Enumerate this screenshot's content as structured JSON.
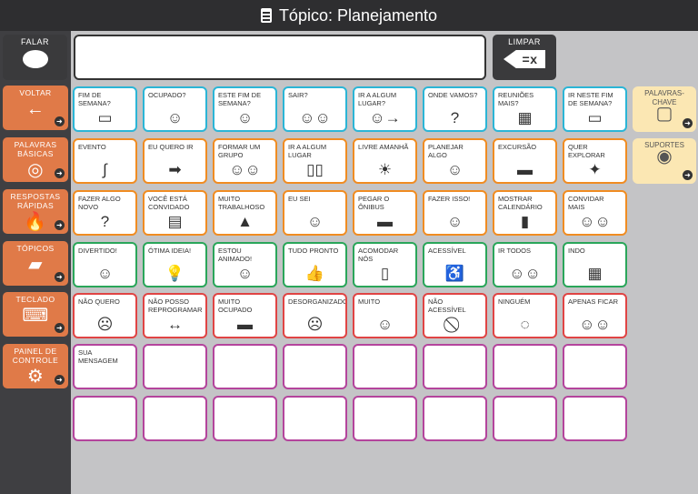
{
  "header": {
    "title": "Tópico: Planejamento",
    "icon": "notebook-icon"
  },
  "toolbar": {
    "speak_label": "Falar",
    "clear_label": "Limpar",
    "message": ""
  },
  "sidebar": [
    {
      "label": "Voltar",
      "icon": "←"
    },
    {
      "label": "Palavras Básicas",
      "icon": "◎"
    },
    {
      "label": "Respostas Rápidas",
      "icon": "🔥"
    },
    {
      "label": "Tópicos",
      "icon": "▰"
    },
    {
      "label": "Teclado",
      "icon": "⌨"
    },
    {
      "label": "Painel de controle",
      "icon": "⚙"
    }
  ],
  "keywords": [
    {
      "label": "Palavras-chave",
      "icon": "▢"
    },
    {
      "label": "Suportes",
      "icon": "◉"
    }
  ],
  "grid": [
    [
      {
        "t": "Fim de semana?",
        "i": "▭"
      },
      {
        "t": "Ocupado?",
        "i": "☺"
      },
      {
        "t": "Este fim de semana?",
        "i": "☺"
      },
      {
        "t": "Sair?",
        "i": "☺☺"
      },
      {
        "t": "Ir a algum lugar?",
        "i": "☺→"
      },
      {
        "t": "Onde vamos?",
        "i": "?"
      },
      {
        "t": "Reuniões mais?",
        "i": "▦"
      },
      {
        "t": "Ir neste fim de semana?",
        "i": "▭"
      }
    ],
    [
      {
        "t": "Evento",
        "i": "∫"
      },
      {
        "t": "Eu quero ir",
        "i": "➡"
      },
      {
        "t": "Formar um grupo",
        "i": "☺☺"
      },
      {
        "t": "Ir a algum lugar",
        "i": "▯▯"
      },
      {
        "t": "Livre amanhã",
        "i": "☀"
      },
      {
        "t": "Planejar algo",
        "i": "☺"
      },
      {
        "t": "Excursão",
        "i": "▬"
      },
      {
        "t": "Quer explorar",
        "i": "✦"
      }
    ],
    [
      {
        "t": "Fazer algo novo",
        "i": "?"
      },
      {
        "t": "Você está convidado",
        "i": "▤"
      },
      {
        "t": "Muito trabalhoso",
        "i": "▲"
      },
      {
        "t": "Eu sei",
        "i": "☺"
      },
      {
        "t": "Pegar o ônibus",
        "i": "▬"
      },
      {
        "t": "Fazer isso!",
        "i": "☺"
      },
      {
        "t": "Mostrar calendário",
        "i": "▮"
      },
      {
        "t": "Convidar mais",
        "i": "☺☺"
      }
    ],
    [
      {
        "t": "Divertido!",
        "i": "☺"
      },
      {
        "t": "Ótima ideia!",
        "i": "💡"
      },
      {
        "t": "Estou animado!",
        "i": "☺"
      },
      {
        "t": "Tudo pronto",
        "i": "👍"
      },
      {
        "t": "Acomodar nós",
        "i": "▯"
      },
      {
        "t": "Acessível",
        "i": "♿"
      },
      {
        "t": "Ir todos",
        "i": "☺☺"
      },
      {
        "t": "Indo",
        "i": "▦"
      }
    ],
    [
      {
        "t": "Não quero",
        "i": "☹"
      },
      {
        "t": "Não posso reprogramar",
        "i": "↔"
      },
      {
        "t": "Muito ocupado",
        "i": "▬"
      },
      {
        "t": "Desorganizado",
        "i": "☹"
      },
      {
        "t": "Muito",
        "i": "☺"
      },
      {
        "t": "Não acessível",
        "i": "⃠"
      },
      {
        "t": "Ninguém",
        "i": "◌"
      },
      {
        "t": "Apenas ficar",
        "i": "☺☺"
      }
    ],
    [
      {
        "t": "Sua mensagem",
        "i": ""
      },
      {
        "t": "",
        "i": ""
      },
      {
        "t": "",
        "i": ""
      },
      {
        "t": "",
        "i": ""
      },
      {
        "t": "",
        "i": ""
      },
      {
        "t": "",
        "i": ""
      },
      {
        "t": "",
        "i": ""
      },
      {
        "t": "",
        "i": ""
      }
    ],
    [
      {
        "t": "",
        "i": ""
      },
      {
        "t": "",
        "i": ""
      },
      {
        "t": "",
        "i": ""
      },
      {
        "t": "",
        "i": ""
      },
      {
        "t": "",
        "i": ""
      },
      {
        "t": "",
        "i": ""
      },
      {
        "t": "",
        "i": ""
      },
      {
        "t": "",
        "i": ""
      }
    ]
  ]
}
